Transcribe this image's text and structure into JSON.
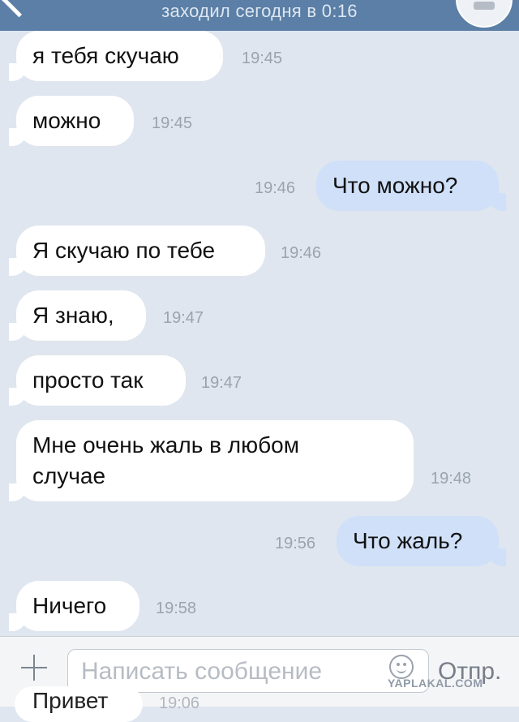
{
  "header": {
    "status": "заходил сегодня в 0:16"
  },
  "messages": [
    {
      "text": "я тебя скучаю",
      "time": "19:45",
      "direction": "in"
    },
    {
      "text": "можно",
      "time": "19:45",
      "direction": "in"
    },
    {
      "text": "Что можно?",
      "time": "19:46",
      "direction": "out"
    },
    {
      "text": "Я скучаю по тебе",
      "time": "19:46",
      "direction": "in"
    },
    {
      "text": "Я знаю,",
      "time": "19:47",
      "direction": "in"
    },
    {
      "text": "просто так",
      "time": "19:47",
      "direction": "in"
    },
    {
      "text_line1": "Мне очень жаль в любом",
      "text_line2": "случае",
      "time": "19:48",
      "direction": "in"
    },
    {
      "text": "Что жаль?",
      "time": "19:56",
      "direction": "out"
    },
    {
      "text": "Ничего",
      "time": "19:58",
      "direction": "in"
    }
  ],
  "composer": {
    "placeholder": "Написать сообщение",
    "send_label": "Отпр."
  },
  "peek": {
    "text": "Привет",
    "time": "19:06"
  },
  "watermark": "YAPLAKAL.COM",
  "colors": {
    "header": "#5b7fa6",
    "background": "#dfe6ef",
    "incoming_bubble": "#ffffff",
    "outgoing_bubble": "#cfe0f8"
  },
  "icons": [
    "back-chevron-icon",
    "avatar-icon",
    "plus-icon",
    "smiley-icon"
  ]
}
